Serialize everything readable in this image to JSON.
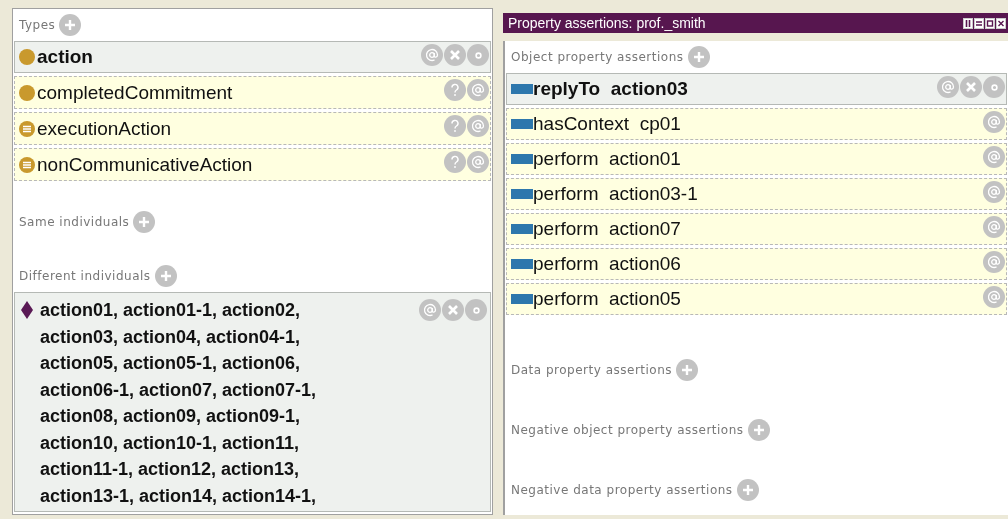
{
  "types": {
    "label": "Types",
    "items": [
      {
        "label": "action",
        "kind": "asserted",
        "defined": false
      },
      {
        "label": "completedCommitment",
        "kind": "inferred",
        "defined": false
      },
      {
        "label": "executionAction",
        "kind": "inferred",
        "defined": true
      },
      {
        "label": "nonCommunicativeAction",
        "kind": "inferred",
        "defined": true
      }
    ]
  },
  "same_individuals": {
    "label": "Same individuals"
  },
  "different_individuals": {
    "label": "Different individuals",
    "item": {
      "kind": "asserted",
      "lines": [
        "action01, action01-1, action02,",
        "action03, action04, action04-1,",
        "action05, action05-1, action06,",
        "action06-1, action07, action07-1,",
        "action08, action09, action09-1,",
        "action10, action10-1, action11,",
        "action11-1, action12, action13,",
        "action13-1, action14, action14-1,"
      ]
    }
  },
  "property_panel": {
    "title": "Property assertions: prof._smith",
    "object_property_assertions": {
      "label": "Object property assertions",
      "items": [
        {
          "property": "replyTo",
          "value": "action03",
          "kind": "asserted"
        },
        {
          "property": "hasContext",
          "value": "cp01",
          "kind": "inferred"
        },
        {
          "property": "perform",
          "value": "action01",
          "kind": "inferred"
        },
        {
          "property": "perform",
          "value": "action03-1",
          "kind": "inferred"
        },
        {
          "property": "perform",
          "value": "action07",
          "kind": "inferred"
        },
        {
          "property": "perform",
          "value": "action06",
          "kind": "inferred"
        },
        {
          "property": "perform",
          "value": "action05",
          "kind": "inferred"
        }
      ]
    },
    "sections": [
      {
        "label": "Data property assertions"
      },
      {
        "label": "Negative object property assertions"
      },
      {
        "label": "Negative data property assertions"
      }
    ]
  }
}
